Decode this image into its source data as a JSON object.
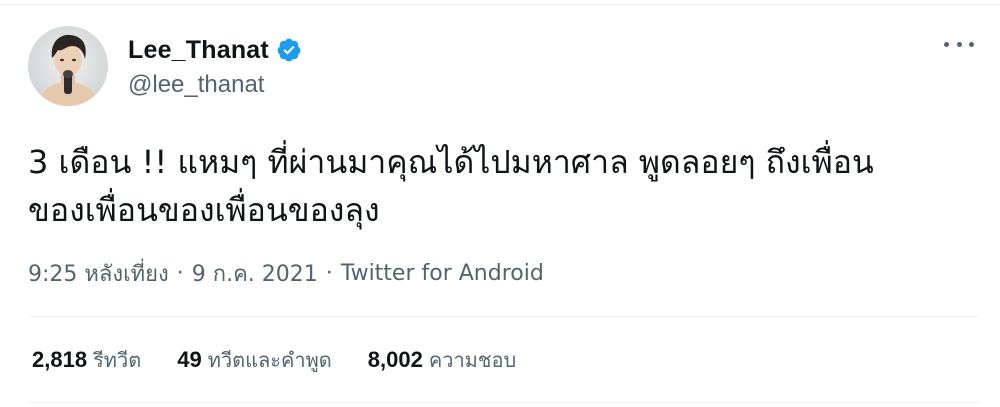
{
  "author": {
    "display_name": "Lee_Thanat",
    "handle": "@lee_thanat",
    "verified": true,
    "verified_color": "#1d9bf0"
  },
  "tweet": {
    "text": "3 เดือน !! แหมๆ ที่ผ่านมาคุณได้ไปมหาศาล พูดลอยๆ ถึงเพื่อน\nของเพื่อนของเพื่อนของลุง",
    "time": "9:25 หลังเที่ยง",
    "separator": "·",
    "date": "9 ก.ค. 2021",
    "source": "Twitter for Android"
  },
  "stats": {
    "retweets_count": "2,818",
    "retweets_label": "รีทวีต",
    "quotes_count": "49",
    "quotes_label": "ทวีตและคำพูด",
    "likes_count": "8,002",
    "likes_label": "ความชอบ"
  },
  "icons": {
    "more": "more-horizontal-icon",
    "verified": "verified-badge-icon",
    "avatar": "profile-photo"
  },
  "colors": {
    "text_primary": "#0f1419",
    "text_secondary": "#536471",
    "divider": "#eff3f4"
  }
}
